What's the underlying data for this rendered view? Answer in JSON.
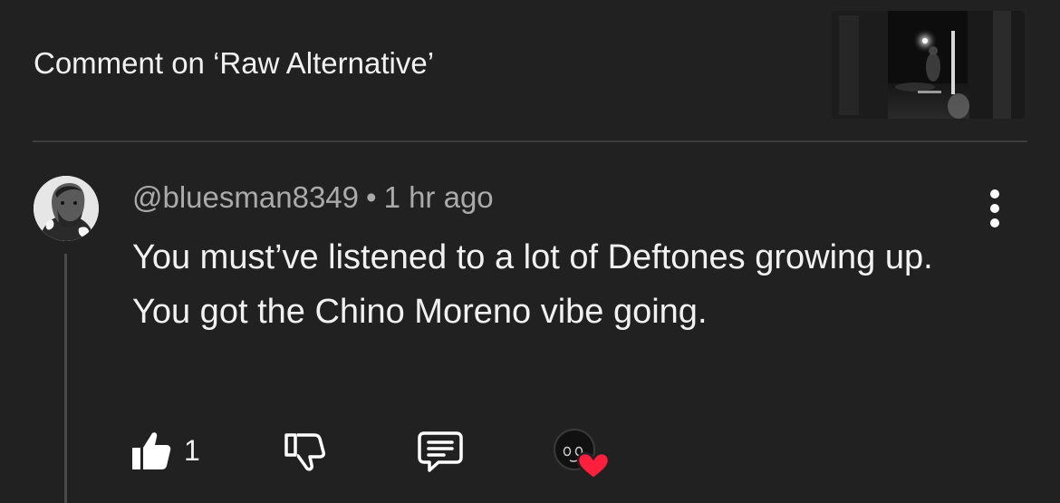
{
  "header": {
    "title": "Comment on ‘Raw Alternative’",
    "thumbnail_icon": "video-thumbnail"
  },
  "comment": {
    "handle": "@bluesman8349",
    "separator": "•",
    "time_ago": "1 hr ago",
    "text": "You must’ve listened to a lot of Deftones growing up. You got the Chino Moreno vibe going.",
    "like_count": "1"
  },
  "icons": {
    "like": "thumbs-up-icon",
    "dislike": "thumbs-down-icon",
    "reply": "reply-comment-icon",
    "creator_heart": "creator-heart-icon",
    "more": "more-vertical-icon"
  },
  "colors": {
    "background": "#212121",
    "heart": "#ff1f3d",
    "secondary_text": "#aaaaaa"
  }
}
